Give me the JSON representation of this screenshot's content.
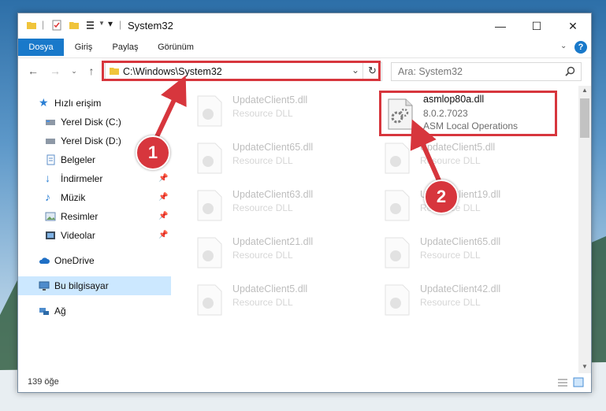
{
  "window": {
    "title": "System32"
  },
  "ribbon": {
    "tabs": [
      "Dosya",
      "Giriş",
      "Paylaş",
      "Görünüm"
    ],
    "help": "?"
  },
  "controls": {
    "minimize": "—",
    "maximize": "☐",
    "close": "✕"
  },
  "nav": {
    "address": "C:\\Windows\\System32",
    "search_placeholder": "Ara: System32"
  },
  "sidebar": {
    "items": [
      {
        "label": "Hızlı erişim",
        "icon": "star-icon"
      },
      {
        "label": "Yerel Disk (C:)",
        "icon": "drive-icon"
      },
      {
        "label": "Yerel Disk (D:)",
        "icon": "drive-icon"
      },
      {
        "label": "Belgeler",
        "icon": "documents-icon"
      },
      {
        "label": "İndirmeler",
        "icon": "download-icon"
      },
      {
        "label": "Müzik",
        "icon": "music-icon"
      },
      {
        "label": "Resimler",
        "icon": "pictures-icon"
      },
      {
        "label": "Videolar",
        "icon": "video-icon"
      },
      {
        "label": "OneDrive",
        "icon": "cloud-icon"
      },
      {
        "label": "Bu bilgisayar",
        "icon": "computer-icon"
      },
      {
        "label": "Ağ",
        "icon": "network-icon"
      }
    ]
  },
  "files": {
    "highlighted": {
      "name": "asmlop80a.dll",
      "version": "8.0.2.7023",
      "description": "ASM Local Operations"
    },
    "ghost": [
      {
        "name": "UpdateClient5.dll",
        "type": "Resource DLL"
      },
      {
        "name": "UpdateClient65.dll",
        "type": "Resource DLL"
      },
      {
        "name": "UpdateClient5.dll",
        "type": "Resource DLL"
      },
      {
        "name": "UpdateClient63.dll",
        "type": "Resource DLL"
      },
      {
        "name": "UpdateClient19.dll",
        "type": "Resource DLL"
      },
      {
        "name": "UpdateClient21.dll",
        "type": "Resource DLL"
      },
      {
        "name": "UpdateClient65.dll",
        "type": "Resource DLL"
      },
      {
        "name": "UpdateClient5.dll",
        "type": "Resource DLL"
      },
      {
        "name": "UpdateClient42.dll",
        "type": "Resource DLL"
      }
    ]
  },
  "status": {
    "count": "139 öğe"
  },
  "annotations": {
    "badge1": "1",
    "badge2": "2"
  },
  "colors": {
    "accent": "#1979ca",
    "highlight": "#d7363d"
  }
}
